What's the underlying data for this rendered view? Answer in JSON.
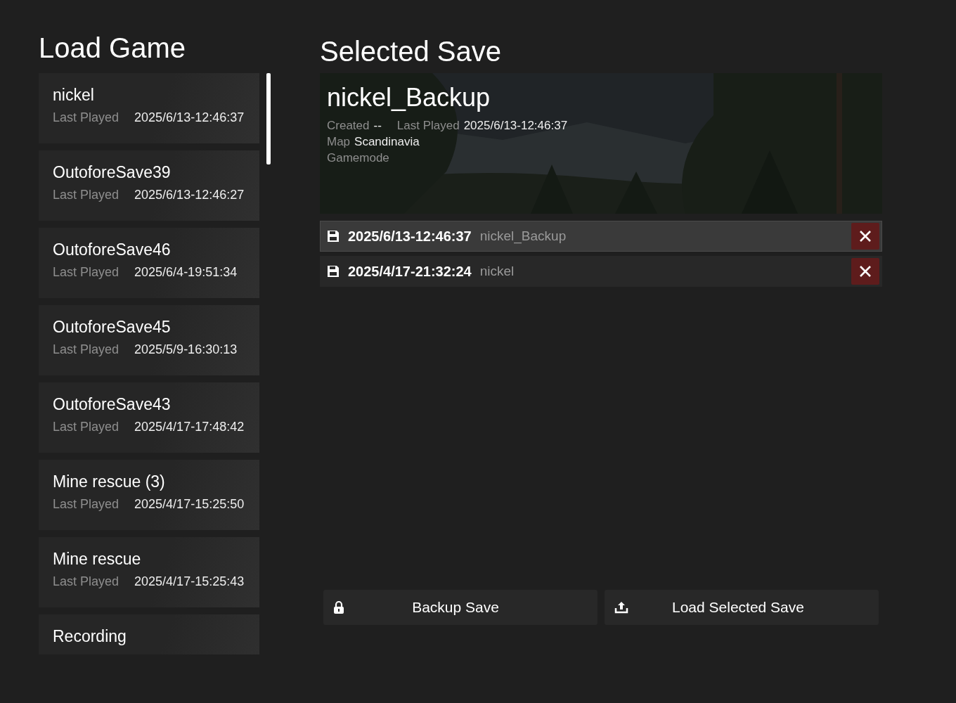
{
  "load_game": {
    "title": "Load Game",
    "saves": [
      {
        "name": "nickel",
        "last_played_label": "Last Played",
        "last_played": "2025/6/13-12:46:37"
      },
      {
        "name": "OutoforeSave39",
        "last_played_label": "Last Played",
        "last_played": "2025/6/13-12:46:27"
      },
      {
        "name": "OutoforeSave46",
        "last_played_label": "Last Played",
        "last_played": "2025/6/4-19:51:34"
      },
      {
        "name": "OutoforeSave45",
        "last_played_label": "Last Played",
        "last_played": "2025/5/9-16:30:13"
      },
      {
        "name": "OutoforeSave43",
        "last_played_label": "Last Played",
        "last_played": "2025/4/17-17:48:42"
      },
      {
        "name": "Mine rescue (3)",
        "last_played_label": "Last Played",
        "last_played": "2025/4/17-15:25:50"
      },
      {
        "name": "Mine rescue",
        "last_played_label": "Last Played",
        "last_played": "2025/4/17-15:25:43"
      },
      {
        "name": "Recording"
      }
    ]
  },
  "selected_save": {
    "title": "Selected Save",
    "name": "nickel_Backup",
    "created_label": "Created",
    "created": "--",
    "last_played_label": "Last Played",
    "last_played": "2025/6/13-12:46:37",
    "map_label": "Map",
    "map": "Scandinavia",
    "gamemode_label": "Gamemode",
    "versions": [
      {
        "date": "2025/6/13-12:46:37",
        "name": "nickel_Backup",
        "selected": true
      },
      {
        "date": "2025/4/17-21:32:24",
        "name": "nickel",
        "selected": false
      }
    ]
  },
  "buttons": [
    {
      "kind": "backup",
      "label": "Backup Save"
    },
    {
      "kind": "load",
      "label": "Load Selected Save"
    }
  ]
}
